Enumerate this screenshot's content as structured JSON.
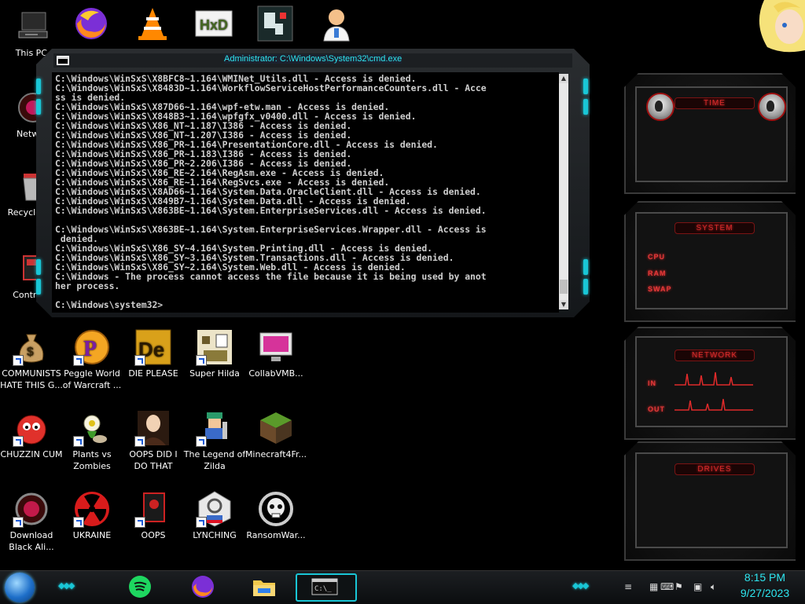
{
  "desktop": {
    "icons": [
      {
        "label": "This PC"
      },
      {
        "label": "Netwo"
      },
      {
        "label": "Recycle"
      },
      {
        "label": "Control"
      },
      {
        "label": "COMMUNISTS HATE THIS G..."
      },
      {
        "label": "Peggle World of Warcraft ..."
      },
      {
        "label": "DIE PLEASE"
      },
      {
        "label": "Super Hilda"
      },
      {
        "label": "CollabVMB..."
      },
      {
        "label": "CHUZZIN CUM"
      },
      {
        "label": "Plants vs Zombies"
      },
      {
        "label": "OOPS DID I DO THAT"
      },
      {
        "label": "The Legend of Zilda"
      },
      {
        "label": "Minecraft4Fr..."
      },
      {
        "label": "Download Black Ali..."
      },
      {
        "label": "UKRAINE"
      },
      {
        "label": "OOPS"
      },
      {
        "label": "LYNCHING"
      },
      {
        "label": "RansomWar..."
      }
    ],
    "top_icons": [
      "firefox-icon",
      "vlc-icon",
      "hxd-icon",
      "game-icon",
      "doctor-icon"
    ]
  },
  "cmd": {
    "title": "Administrator: C:\\Windows\\System32\\cmd.exe",
    "lines": [
      "C:\\Windows\\WinSxS\\X8BFC8~1.164\\WMINet_Utils.dll - Access is denied.",
      "C:\\Windows\\WinSxS\\X8483D~1.164\\WorkflowServiceHostPerformanceCounters.dll - Acce",
      "ss is denied.",
      "C:\\Windows\\WinSxS\\X87D66~1.164\\wpf-etw.man - Access is denied.",
      "C:\\Windows\\WinSxS\\X848B3~1.164\\wpfgfx_v0400.dll - Access is denied.",
      "C:\\Windows\\WinSxS\\X86_NT~1.187\\I386 - Access is denied.",
      "C:\\Windows\\WinSxS\\X86_NT~1.207\\I386 - Access is denied.",
      "C:\\Windows\\WinSxS\\X86_PR~1.164\\PresentationCore.dll - Access is denied.",
      "C:\\Windows\\WinSxS\\X86_PR~1.183\\I386 - Access is denied.",
      "C:\\Windows\\WinSxS\\X86_PR~2.206\\I386 - Access is denied.",
      "C:\\Windows\\WinSxS\\X86_RE~2.164\\RegAsm.exe - Access is denied.",
      "C:\\Windows\\WinSxS\\X86_RE~1.164\\RegSvcs.exe - Access is denied.",
      "C:\\Windows\\WinSxS\\X8AD66~1.164\\System.Data.OracleClient.dll - Access is denied.",
      "C:\\Windows\\WinSxS\\X849B7~1.164\\System.Data.dll - Access is denied.",
      "C:\\Windows\\WinSxS\\X863BE~1.164\\System.EnterpriseServices.dll - Access is denied.",
      "",
      "C:\\Windows\\WinSxS\\X863BE~1.164\\System.EnterpriseServices.Wrapper.dll - Access is",
      " denied.",
      "C:\\Windows\\WinSxS\\X86_SY~4.164\\System.Printing.dll - Access is denied.",
      "C:\\Windows\\WinSxS\\X86_SY~3.164\\System.Transactions.dll - Access is denied.",
      "C:\\Windows\\WinSxS\\X86_SY~2.164\\System.Web.dll - Access is denied.",
      "C:\\Windows - The process cannot access the file because it is being used by anot",
      "her process.",
      "",
      "C:\\Windows\\system32>"
    ]
  },
  "gadgets": {
    "time_title": "TIME",
    "system_title": "SYSTEM",
    "system_labels": [
      "CPU",
      "RAM",
      "SWAP"
    ],
    "network_title": "NETWORK",
    "network_labels": [
      "IN",
      "OUT"
    ],
    "drives_title": "DRIVES"
  },
  "taskbar": {
    "apps": [
      "spotify-icon",
      "firefox-icon",
      "file-explorer-icon",
      "cmd-icon"
    ],
    "clock_time": "8:15 PM",
    "clock_date": "9/27/2023"
  },
  "colors": {
    "accent_cyan": "#19c6d6",
    "alienware_red": "#d32b2b",
    "clock": "#2ee6f0"
  }
}
